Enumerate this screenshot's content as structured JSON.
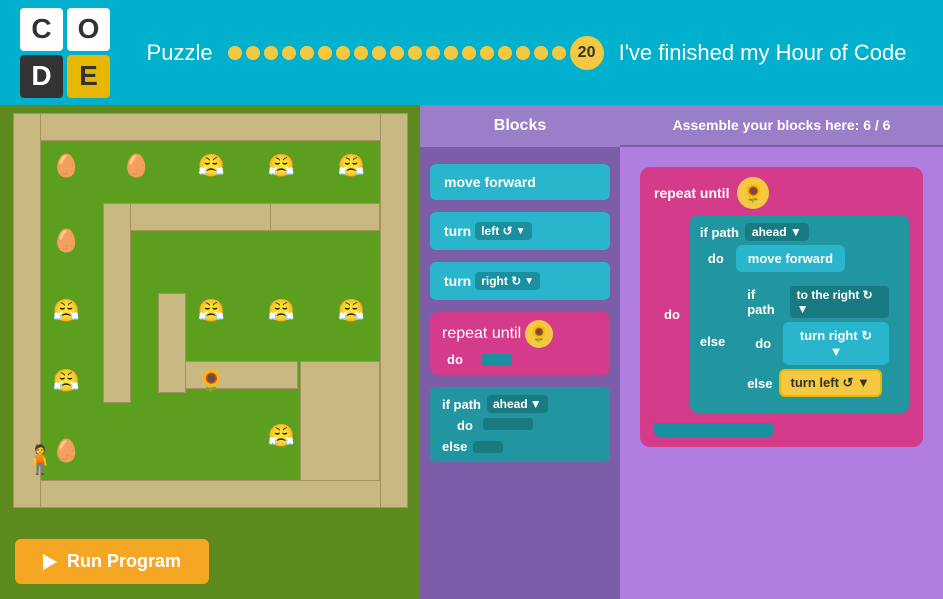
{
  "header": {
    "logo": {
      "c1": "C",
      "o": "O",
      "d": "D",
      "e": "E"
    },
    "puzzle_label": "Puzzle",
    "puzzle_number": "20",
    "finished_text": "I've finished my Hour of Code",
    "dot_count": 19
  },
  "blocks_panel": {
    "header": "Blocks",
    "items": [
      {
        "id": "move-forward",
        "label": "move forward",
        "type": "cyan"
      },
      {
        "id": "turn-left",
        "label": "turn",
        "dropdown": "left ↺",
        "type": "cyan"
      },
      {
        "id": "turn-right",
        "label": "turn",
        "dropdown": "right ↻",
        "type": "cyan"
      },
      {
        "id": "repeat-until",
        "label": "repeat until",
        "type": "pink"
      },
      {
        "id": "if-path",
        "label": "if path",
        "dropdown": "ahead",
        "type": "if"
      }
    ]
  },
  "workspace_panel": {
    "header": "Assemble your blocks here: 6 / 6",
    "repeat_label": "repeat until",
    "do_label": "do",
    "else_label": "else",
    "if_path_label": "if path",
    "ahead_label": "ahead ▼",
    "to_right_label": "to the right ↻ ▼",
    "move_forward_label": "move forward",
    "turn_right_label": "turn right ↻ ▼",
    "turn_left_label": "turn left ↺ ▼"
  },
  "run_button": {
    "label": "Run Program"
  }
}
